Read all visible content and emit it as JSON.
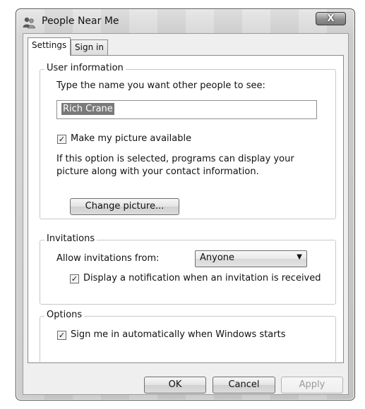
{
  "window": {
    "title": "People Near Me",
    "icon": "people-icon",
    "close_glyph": "X"
  },
  "tabs": [
    {
      "label": "Settings",
      "active": true
    },
    {
      "label": "Sign in",
      "active": false
    }
  ],
  "user_information": {
    "legend": "User information",
    "name_prompt": "Type the name you want other people to see:",
    "name_value": "Rich Crane",
    "picture_checkbox_label": "Make my picture available",
    "picture_checked": true,
    "info_line1": "If this option is selected, programs can display your",
    "info_line2": "picture along with your contact information.",
    "change_picture_button": "Change picture..."
  },
  "invitations": {
    "legend": "Invitations",
    "allow_label": "Allow invitations from:",
    "allow_value": "Anyone",
    "notification_label": "Display a notification when an invitation is received",
    "notification_checked": true
  },
  "options": {
    "legend": "Options",
    "auto_signin_label": "Sign me in automatically when Windows starts",
    "auto_signin_checked": true
  },
  "buttons": {
    "ok": "OK",
    "cancel": "Cancel",
    "apply": "Apply"
  },
  "glyphs": {
    "check": "✓",
    "dropdown": "▼"
  }
}
